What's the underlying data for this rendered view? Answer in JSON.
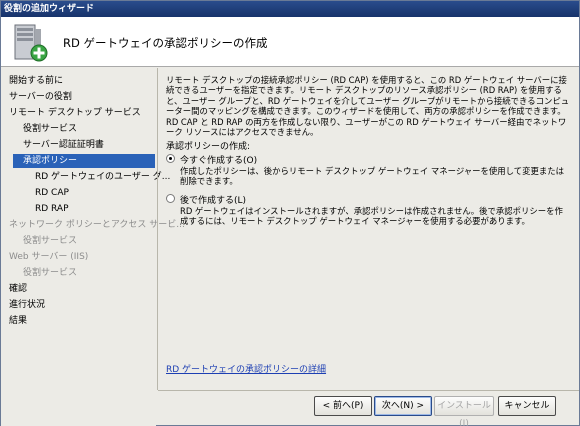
{
  "window": {
    "title": "役割の追加ウィザード"
  },
  "header": {
    "title": "RD ゲートウェイの承認ポリシーの作成",
    "icon": "server-add-icon"
  },
  "sidebar": {
    "items": [
      {
        "label": "開始する前に",
        "level": 0,
        "state": "normal"
      },
      {
        "label": "サーバーの役割",
        "level": 0,
        "state": "normal"
      },
      {
        "label": "リモート デスクトップ サービス",
        "level": 0,
        "state": "normal"
      },
      {
        "label": "役割サービス",
        "level": 1,
        "state": "normal"
      },
      {
        "label": "サーバー認証証明書",
        "level": 1,
        "state": "normal"
      },
      {
        "label": "承認ポリシー",
        "level": 1,
        "state": "selected"
      },
      {
        "label": "RD ゲートウェイのユーザー グ...",
        "level": 2,
        "state": "normal"
      },
      {
        "label": "RD CAP",
        "level": 2,
        "state": "normal"
      },
      {
        "label": "RD RAP",
        "level": 2,
        "state": "normal"
      },
      {
        "label": "ネットワーク ポリシーとアクセス サービ...",
        "level": 0,
        "state": "disabled"
      },
      {
        "label": "役割サービス",
        "level": 1,
        "state": "disabled"
      },
      {
        "label": "Web サーバー (IIS)",
        "level": 0,
        "state": "disabled"
      },
      {
        "label": "役割サービス",
        "level": 1,
        "state": "disabled"
      },
      {
        "label": "確認",
        "level": 0,
        "state": "normal"
      },
      {
        "label": "進行状況",
        "level": 0,
        "state": "normal"
      },
      {
        "label": "結果",
        "level": 0,
        "state": "normal"
      }
    ]
  },
  "main": {
    "description": "リモート デスクトップの接続承認ポリシー (RD CAP) を使用すると、この RD ゲートウェイ サーバーに接続できるユーザーを指定できます。リモート デスクトップのリソース承認ポリシー (RD RAP) を使用すると、ユーザー グループと、RD ゲートウェイを介してユーザー グループがリモートから接続できるコンピューター間のマッピングを構成できます。このウィザードを使用して、両方の承認ポリシーを作成できます。RD CAP と RD RAP の両方を作成しない限り、ユーザーがこの RD ゲートウェイ サーバー経由でネットワーク リソースにはアクセスできません。",
    "choice_label": "承認ポリシーの作成:",
    "options": [
      {
        "label": "今すぐ作成する(O)",
        "description": "作成したポリシーは、後からリモート デスクトップ ゲートウェイ マネージャーを使用して変更または削除できます。",
        "checked": true
      },
      {
        "label": "後で作成する(L)",
        "description": "RD ゲートウェイはインストールされますが、承認ポリシーは作成されません。後で承認ポリシーを作成するには、リモート デスクトップ ゲートウェイ マネージャーを使用する必要があります。",
        "checked": false
      }
    ],
    "more_link": "RD ゲートウェイの承認ポリシーの詳細"
  },
  "buttons": {
    "back": "< 前へ(P)",
    "next": "次へ(N) >",
    "install": "インストール(I)",
    "cancel": "キャンセル"
  }
}
